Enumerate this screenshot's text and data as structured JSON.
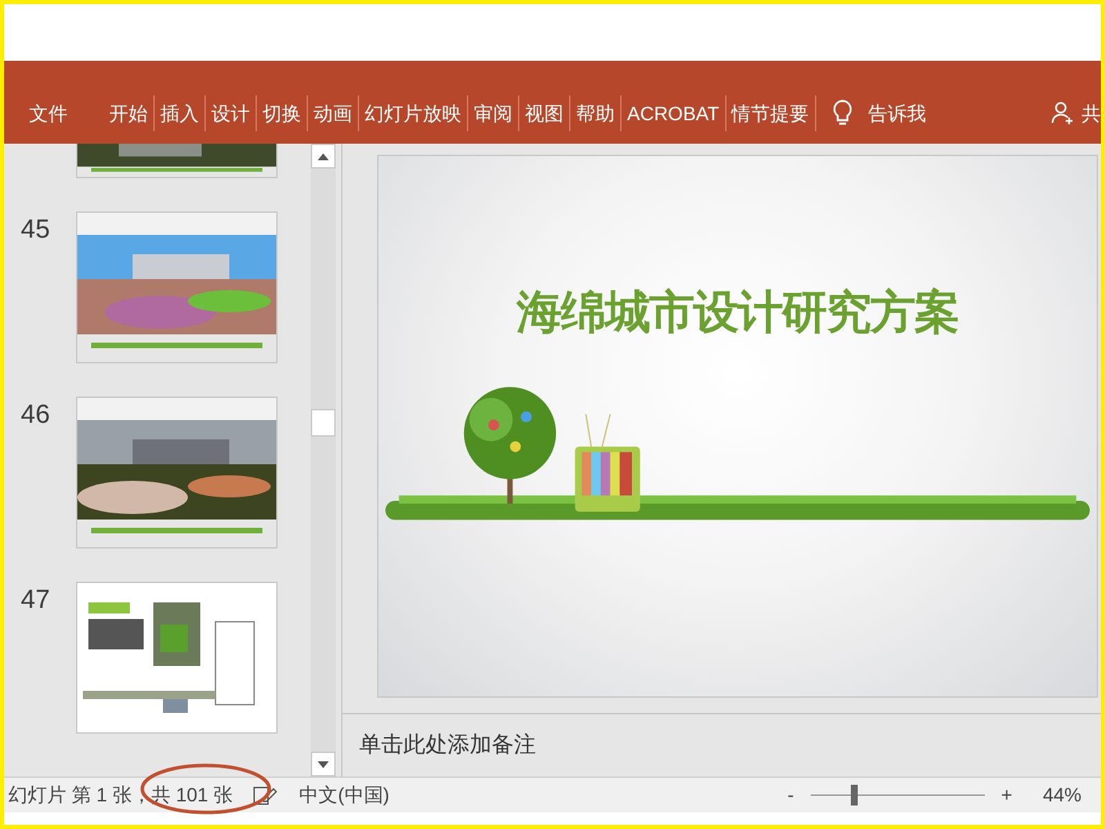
{
  "ribbon": {
    "tabs": [
      {
        "label": "文件"
      },
      {
        "label": "开始"
      },
      {
        "label": "插入"
      },
      {
        "label": "设计"
      },
      {
        "label": "切换"
      },
      {
        "label": "动画"
      },
      {
        "label": "幻灯片放映"
      },
      {
        "label": "审阅"
      },
      {
        "label": "视图"
      },
      {
        "label": "帮助"
      },
      {
        "label": "ACROBAT"
      },
      {
        "label": "情节提要"
      }
    ],
    "tell_me": "告诉我",
    "share": "共"
  },
  "thumbnails": [
    {
      "kind": "cropped"
    },
    {
      "number": "45"
    },
    {
      "number": "46"
    },
    {
      "number": "47",
      "kind": "document"
    }
  ],
  "slide": {
    "title": "海绵城市设计研究方案"
  },
  "notes": {
    "placeholder": "单击此处添加备注"
  },
  "status_bar": {
    "slide_info": "幻灯片 第 1 张，共 101 张",
    "language": "中文(中国)",
    "zoom": {
      "minus": "-",
      "plus": "+",
      "level": 0.25,
      "percent": "44%"
    }
  }
}
